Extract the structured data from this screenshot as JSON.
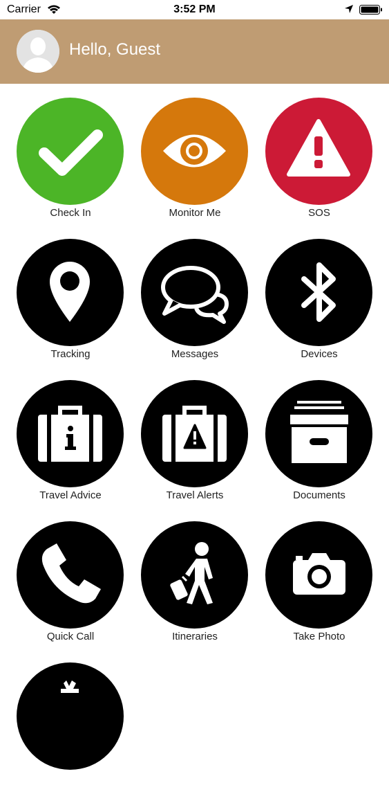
{
  "status_bar": {
    "carrier": "Carrier",
    "time": "3:52 PM"
  },
  "header": {
    "greeting": "Hello, Guest",
    "background_color": "#bf9c73"
  },
  "tiles": [
    {
      "label": "Check In",
      "icon": "checkmark-icon",
      "color": "#4cb527"
    },
    {
      "label": "Monitor Me",
      "icon": "eye-icon",
      "color": "#d5780c"
    },
    {
      "label": "SOS",
      "icon": "warning-icon",
      "color": "#cc1a36"
    },
    {
      "label": "Tracking",
      "icon": "location-pin-icon",
      "color": "#000000"
    },
    {
      "label": "Messages",
      "icon": "chat-bubbles-icon",
      "color": "#000000"
    },
    {
      "label": "Devices",
      "icon": "bluetooth-icon",
      "color": "#000000"
    },
    {
      "label": "Travel Advice",
      "icon": "suitcase-info-icon",
      "color": "#000000"
    },
    {
      "label": "Travel Alerts",
      "icon": "suitcase-alert-icon",
      "color": "#000000"
    },
    {
      "label": "Documents",
      "icon": "file-box-icon",
      "color": "#000000"
    },
    {
      "label": "Quick Call",
      "icon": "phone-icon",
      "color": "#000000"
    },
    {
      "label": "Itineraries",
      "icon": "traveler-icon",
      "color": "#000000"
    },
    {
      "label": "Take Photo",
      "icon": "camera-icon",
      "color": "#000000"
    },
    {
      "label": "",
      "icon": "partially-visible-icon",
      "color": "#000000"
    }
  ]
}
